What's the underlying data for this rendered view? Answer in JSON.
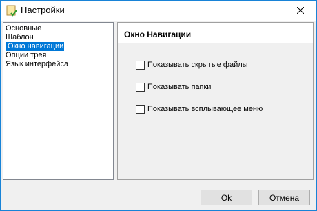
{
  "window": {
    "title": "Настройки",
    "app_icon": "settings-checklist-icon",
    "close_icon": "close-icon"
  },
  "nav": {
    "items": [
      {
        "label": "Основные",
        "selected": false
      },
      {
        "label": "Шаблон",
        "selected": false
      },
      {
        "label": "Окно навигации",
        "selected": true
      },
      {
        "label": "Опции трея",
        "selected": false
      },
      {
        "label": "Язык интерфейса",
        "selected": false
      }
    ],
    "selected_bg": "#0078d7"
  },
  "panel": {
    "title": "Окно Навигации",
    "options": [
      {
        "label": "Показывать скрытые файлы",
        "checked": false
      },
      {
        "label": "Показывать папки",
        "checked": false
      },
      {
        "label": "Показывать всплывающее меню",
        "checked": false
      }
    ]
  },
  "buttons": {
    "ok_label": "Ok",
    "cancel_label": "Отмена"
  }
}
